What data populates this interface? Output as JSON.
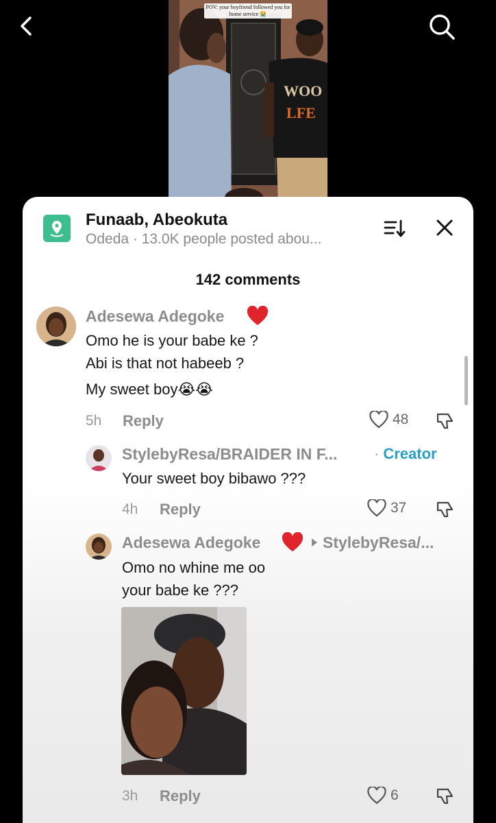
{
  "video": {
    "caption": "POV: your boyfriend followed you for home service 😭"
  },
  "sheet": {
    "location_title": "Funaab, Abeokuta",
    "location_subtitle": "Odeda · 13.0K people posted abou...",
    "comments_count": "142 comments"
  },
  "comments": [
    {
      "user": "Adesewa Adegoke",
      "lines": [
        "Omo he is your babe ke ?",
        "Abi is that not habeeb ?",
        "My sweet boy😭😭"
      ],
      "time": "5h",
      "reply_label": "Reply",
      "likes": "48"
    },
    {
      "user": "StylebyResa/BRAIDER IN F...",
      "badge": "Creator",
      "lines": [
        "Your sweet boy bibawo ???"
      ],
      "time": "4h",
      "reply_label": "Reply",
      "likes": "37"
    },
    {
      "user": "Adesewa Adegoke",
      "reply_to": "StylebyResa/...",
      "lines": [
        "Omo no whine me oo",
        "your babe ke ???"
      ],
      "time": "3h",
      "reply_label": "Reply",
      "likes": "6"
    }
  ],
  "colors": {
    "accent_creator": "#2a9fc0",
    "location_icon": "#3ebd8f",
    "heart_red": "#e0242b"
  }
}
